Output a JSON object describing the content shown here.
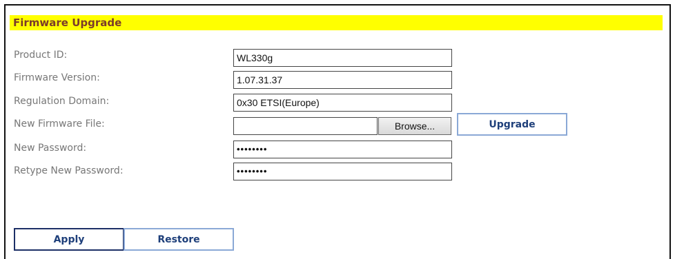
{
  "page": {
    "title": "Firmware Upgrade"
  },
  "form": {
    "product_id_label": "Product ID:",
    "product_id_value": "WL330g",
    "firmware_version_label": "Firmware Version:",
    "firmware_version_value": "1.07.31.37",
    "regulation_domain_label": "Regulation Domain:",
    "regulation_domain_value": "0x30 ETSI(Europe)",
    "new_firmware_file_label": "New Firmware File:",
    "new_firmware_file_value": "",
    "browse_label": "Browse...",
    "upgrade_label": "Upgrade",
    "new_password_label": "New Password:",
    "new_password_value": "••••••••",
    "retype_password_label": "Retype New Password:",
    "retype_password_value": "••••••••"
  },
  "actions": {
    "apply_label": "Apply",
    "restore_label": "Restore"
  },
  "colors": {
    "title_bar": "#ffff00",
    "title_text": "#7b3b2a",
    "button_border": "#8aa8d6",
    "button_text": "#1e3f7a"
  }
}
